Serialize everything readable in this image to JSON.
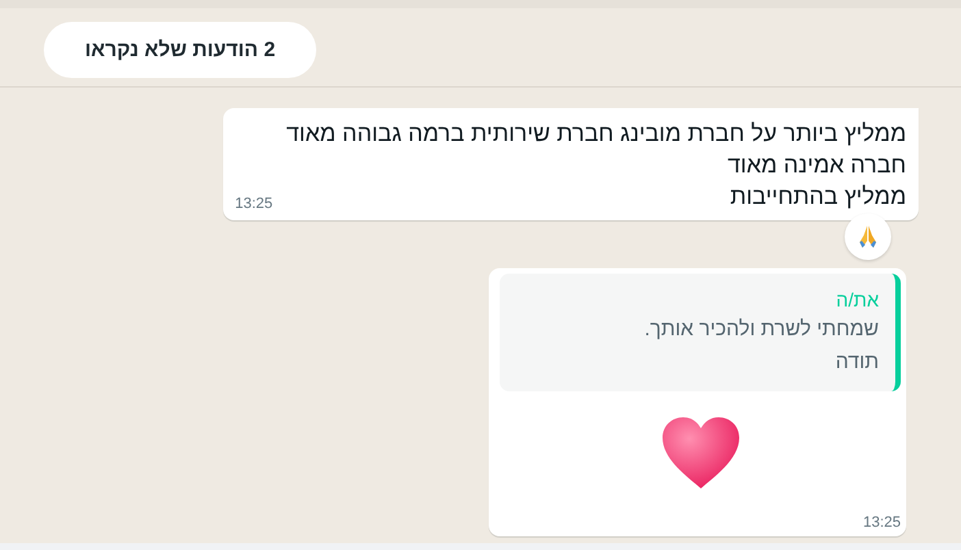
{
  "unread_banner": {
    "text": "2 הודעות שלא נקראו"
  },
  "messages": [
    {
      "kind": "text",
      "lines": [
        "ממליץ ביותר על חברת מובינג חברת שירותית ברמה גבוהה מאוד",
        "חברה אמינה מאוד",
        "ממליץ בהתחייבות"
      ],
      "time": "13:25",
      "reaction": true
    },
    {
      "kind": "reply",
      "quote": {
        "author": "את/ה",
        "lines": [
          "שמחתי לשרת ולהכיר אותך.",
          "תודה"
        ]
      },
      "time": "13:25",
      "reaction": false
    }
  ]
}
